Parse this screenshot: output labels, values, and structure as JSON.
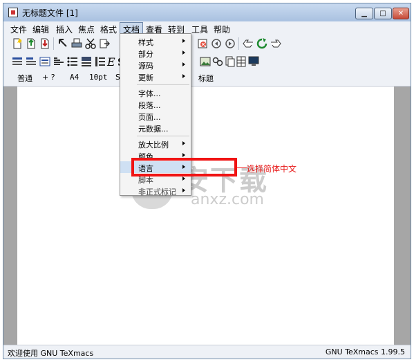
{
  "window": {
    "title": "无标题文件 [1]"
  },
  "menubar": {
    "items": [
      {
        "label": "文件"
      },
      {
        "label": "编辑"
      },
      {
        "label": "插入"
      },
      {
        "label": "焦点"
      },
      {
        "label": "格式"
      },
      {
        "label": "文档"
      },
      {
        "label": "查看"
      },
      {
        "label": "转到"
      },
      {
        "label": "工具"
      },
      {
        "label": "帮助"
      }
    ]
  },
  "format_bar": {
    "style": "普通",
    "plus_q": "+ ?",
    "paper": "A4",
    "font_size": "10pt",
    "font_initial": "S",
    "title_button": "标题"
  },
  "document_menu": {
    "items": [
      {
        "label": "样式",
        "submenu": true
      },
      {
        "label": "部分",
        "submenu": true
      },
      {
        "label": "源码",
        "submenu": true
      },
      {
        "label": "更新",
        "submenu": true
      },
      {
        "label": "字体...",
        "submenu": false
      },
      {
        "label": "段落...",
        "submenu": false
      },
      {
        "label": "页面...",
        "submenu": false
      },
      {
        "label": "元数据...",
        "submenu": false
      },
      {
        "label": "放大比例",
        "submenu": true
      },
      {
        "label": "颜色",
        "submenu": true
      },
      {
        "label": "语言",
        "submenu": true
      },
      {
        "label": "脚本",
        "submenu": true
      },
      {
        "label": "非正式标记",
        "submenu": true
      }
    ]
  },
  "annotation": {
    "text": "选择简体中文",
    "color": "#f01414"
  },
  "watermark": {
    "cn": "安下载",
    "en": "anxz.com"
  },
  "status": {
    "left": "欢迎使用 GNU TeXmacs",
    "right": "GNU TeXmacs 1.99.5"
  }
}
